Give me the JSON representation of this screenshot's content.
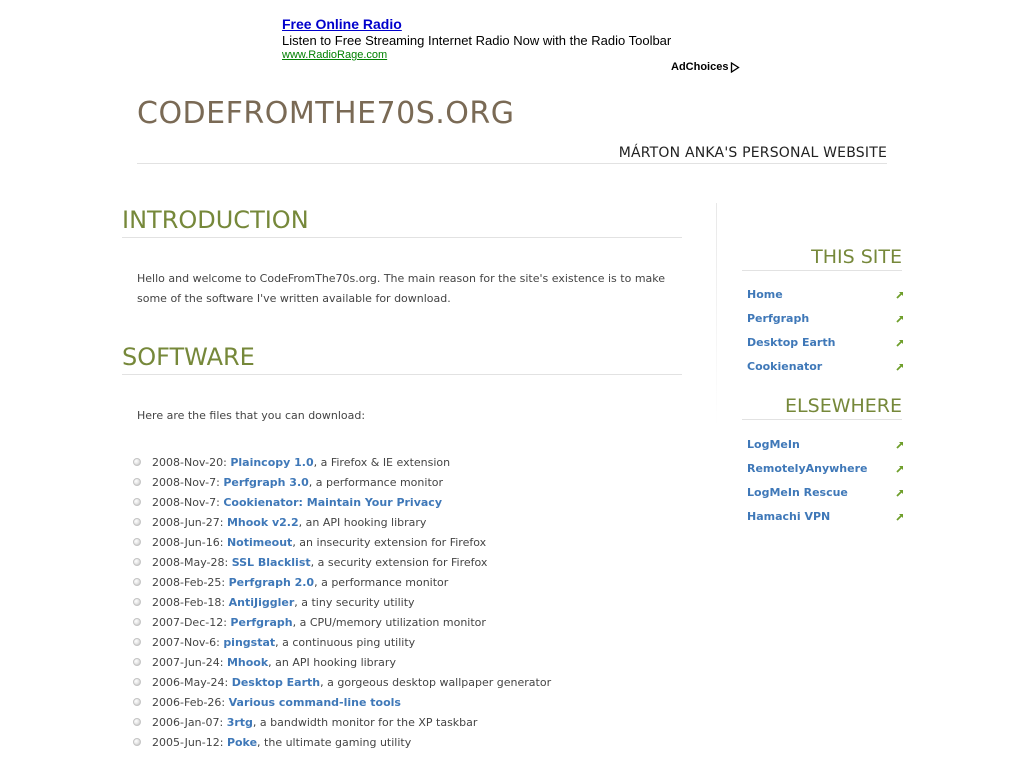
{
  "ad": {
    "title": "Free Online Radio",
    "text": "Listen to Free Streaming Internet Radio Now with the Radio Toolbar",
    "url": "www.RadioRage.com",
    "choices": "AdChoices"
  },
  "header": {
    "title": "CODEFROMTHE70S.ORG",
    "subtitle": "MÁRTON ANKA'S PERSONAL WEBSITE"
  },
  "intro": {
    "heading": "INTRODUCTION",
    "text": "Hello and welcome to CodeFromThe70s.org. The main reason for the site's existence is to make some of the software I've written available for download."
  },
  "software": {
    "heading": "SOFTWARE",
    "text": "Here are the files that you can download:",
    "files": [
      {
        "date": "2008-Nov-20: ",
        "name": "Plaincopy 1.0",
        "desc": ", a Firefox & IE extension"
      },
      {
        "date": "2008-Nov-7: ",
        "name": "Perfgraph 3.0",
        "desc": ", a performance monitor"
      },
      {
        "date": "2008-Nov-7: ",
        "name": "Cookienator: Maintain Your Privacy",
        "desc": ""
      },
      {
        "date": "2008-Jun-27: ",
        "name": "Mhook v2.2",
        "desc": ", an API hooking library"
      },
      {
        "date": "2008-Jun-16: ",
        "name": "Notimeout",
        "desc": ", an insecurity extension for Firefox"
      },
      {
        "date": "2008-May-28: ",
        "name": "SSL Blacklist",
        "desc": ", a security extension for Firefox"
      },
      {
        "date": "2008-Feb-25: ",
        "name": "Perfgraph 2.0",
        "desc": ", a performance monitor"
      },
      {
        "date": "2008-Feb-18: ",
        "name": "AntiJiggler",
        "desc": ", a tiny security utility"
      },
      {
        "date": "2007-Dec-12: ",
        "name": "Perfgraph",
        "desc": ", a CPU/memory utilization monitor"
      },
      {
        "date": "2007-Nov-6: ",
        "name": "pingstat",
        "desc": ", a continuous ping utility"
      },
      {
        "date": "2007-Jun-24: ",
        "name": "Mhook",
        "desc": ", an API hooking library"
      },
      {
        "date": "2006-May-24: ",
        "name": "Desktop Earth",
        "desc": ", a gorgeous desktop wallpaper generator"
      },
      {
        "date": "2006-Feb-26: ",
        "name": "Various command-line tools",
        "desc": ""
      },
      {
        "date": "2006-Jan-07: ",
        "name": "3rtg",
        "desc": ", a bandwidth monitor for the XP taskbar"
      },
      {
        "date": "2005-Jun-12: ",
        "name": "Poke",
        "desc": ", the ultimate gaming utility"
      }
    ]
  },
  "sidebar": {
    "this_site": {
      "heading": "THIS SITE",
      "links": [
        "Home",
        "Perfgraph",
        "Desktop Earth",
        "Cookienator"
      ]
    },
    "elsewhere": {
      "heading": "ELSEWHERE",
      "links": [
        "LogMeIn",
        "RemotelyAnywhere",
        "LogMeIn Rescue",
        "Hamachi VPN"
      ]
    }
  },
  "colors": {
    "accent_green": "#76883a",
    "link_blue": "#3f78b8",
    "title_brown": "#7a6a55"
  },
  "icons": {
    "bullet": "circle-bullet-icon",
    "link_arrow": "arrow-up-right-icon",
    "adchoices": "play-triangle-icon"
  }
}
